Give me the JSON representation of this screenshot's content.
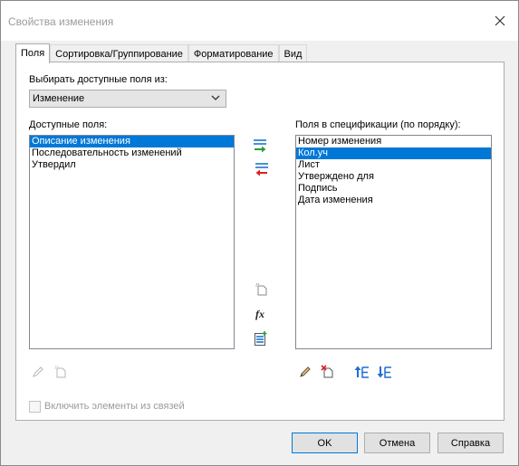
{
  "window": {
    "title": "Свойства изменения"
  },
  "tabs": [
    {
      "label": "Поля",
      "active": true
    },
    {
      "label": "Сортировка/Группирование",
      "active": false
    },
    {
      "label": "Форматирование",
      "active": false
    },
    {
      "label": "Вид",
      "active": false
    }
  ],
  "fields_panel": {
    "select_source_label": "Выбирать доступные поля из:",
    "select_source_value": "Изменение",
    "available_label": "Доступные поля:",
    "available_fields": [
      "Описание изменения",
      "Последовательность изменений",
      "Утвердил"
    ],
    "available_selected_index": 0,
    "scheduled_label": "Поля в спецификации (по порядку):",
    "scheduled_fields": [
      "Номер изменения",
      "Кол.уч",
      "Лист",
      "Утверждено для",
      "Подпись",
      "Дата изменения"
    ],
    "scheduled_selected_index": 1,
    "include_links_label": "Включить элементы из связей",
    "include_links_checked": false
  },
  "buttons": {
    "ok": "OK",
    "cancel": "Отмена",
    "help": "Справка"
  },
  "colors": {
    "selection": "#0078d7",
    "add_arrow": "#2e9c3a",
    "remove_arrow": "#e02020"
  }
}
